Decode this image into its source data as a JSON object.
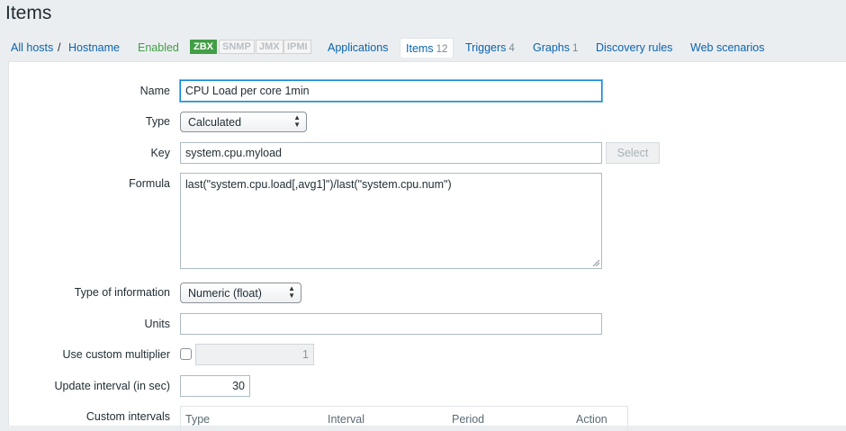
{
  "page": {
    "title": "Items"
  },
  "nav": {
    "all_hosts": "All hosts",
    "separator": "/",
    "hostname": "Hostname",
    "status": "Enabled",
    "badges": [
      "ZBX",
      "SNMP",
      "JMX",
      "IPMI"
    ],
    "applications": "Applications",
    "items": "Items",
    "items_count": "12",
    "triggers": "Triggers",
    "triggers_count": "4",
    "graphs": "Graphs",
    "graphs_count": "1",
    "discovery_rules": "Discovery rules",
    "web_scenarios": "Web scenarios"
  },
  "form": {
    "name_label": "Name",
    "name_value": "CPU Load per core 1min",
    "type_label": "Type",
    "type_value": "Calculated",
    "key_label": "Key",
    "key_value": "system.cpu.myload",
    "select_button": "Select",
    "formula_label": "Formula",
    "formula_value": "last(\"system.cpu.load[,avg1]\")/last(\"system.cpu.num\")",
    "type_of_info_label": "Type of information",
    "type_of_info_value": "Numeric (float)",
    "units_label": "Units",
    "units_value": "",
    "multiplier_label": "Use custom multiplier",
    "multiplier_value": "1",
    "update_interval_label": "Update interval (in sec)",
    "update_interval_value": "30",
    "custom_intervals_label": "Custom intervals",
    "custom_intervals_columns": [
      "Type",
      "Interval",
      "Period",
      "Action"
    ]
  }
}
